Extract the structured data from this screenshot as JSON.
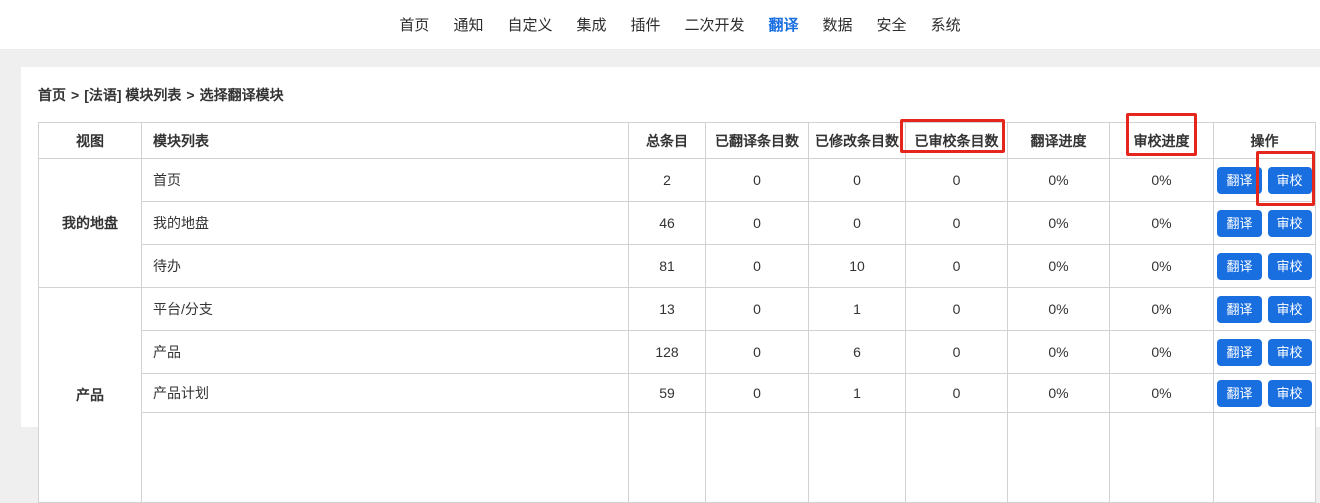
{
  "nav": {
    "items": [
      {
        "label": "首页",
        "active": false
      },
      {
        "label": "通知",
        "active": false
      },
      {
        "label": "自定义",
        "active": false
      },
      {
        "label": "集成",
        "active": false
      },
      {
        "label": "插件",
        "active": false
      },
      {
        "label": "二次开发",
        "active": false
      },
      {
        "label": "翻译",
        "active": true
      },
      {
        "label": "数据",
        "active": false
      },
      {
        "label": "安全",
        "active": false
      },
      {
        "label": "系统",
        "active": false
      }
    ]
  },
  "breadcrumb": {
    "segments": [
      "首页",
      "[法语] 模块列表",
      "选择翻译模块"
    ],
    "separator": ">"
  },
  "table": {
    "columns": [
      "视图",
      "模块列表",
      "总条目",
      "已翻译条目数",
      "已修改条目数",
      "已审校条目数",
      "翻译进度",
      "审校进度",
      "操作"
    ],
    "action_buttons": {
      "translate": "翻译",
      "review": "审校"
    },
    "groups": [
      {
        "label": "我的地盘",
        "continues_below": false,
        "rows": [
          {
            "module": "首页",
            "total": "2",
            "translated": "0",
            "modified": "0",
            "reviewed": "0",
            "translate_progress": "0%",
            "review_progress": "0%"
          },
          {
            "module": "我的地盘",
            "total": "46",
            "translated": "0",
            "modified": "0",
            "reviewed": "0",
            "translate_progress": "0%",
            "review_progress": "0%"
          },
          {
            "module": "待办",
            "total": "81",
            "translated": "0",
            "modified": "10",
            "reviewed": "0",
            "translate_progress": "0%",
            "review_progress": "0%"
          }
        ]
      },
      {
        "label": "产品",
        "continues_below": true,
        "rows": [
          {
            "module": "平台/分支",
            "total": "13",
            "translated": "0",
            "modified": "1",
            "reviewed": "0",
            "translate_progress": "0%",
            "review_progress": "0%"
          },
          {
            "module": "产品",
            "total": "128",
            "translated": "0",
            "modified": "6",
            "reviewed": "0",
            "translate_progress": "0%",
            "review_progress": "0%"
          },
          {
            "module": "产品计划",
            "total": "59",
            "translated": "0",
            "modified": "1",
            "reviewed": "0",
            "translate_progress": "0%",
            "review_progress": "0%"
          }
        ]
      }
    ]
  },
  "annotations": {
    "color": "#e4261d",
    "boxes": [
      "reviewed-count-column-header",
      "review-progress-column-header",
      "first-row-review-button"
    ]
  },
  "colors": {
    "accent_blue": "#1a6fe0",
    "annotation_red": "#e4261d",
    "page_background": "#efefef"
  }
}
